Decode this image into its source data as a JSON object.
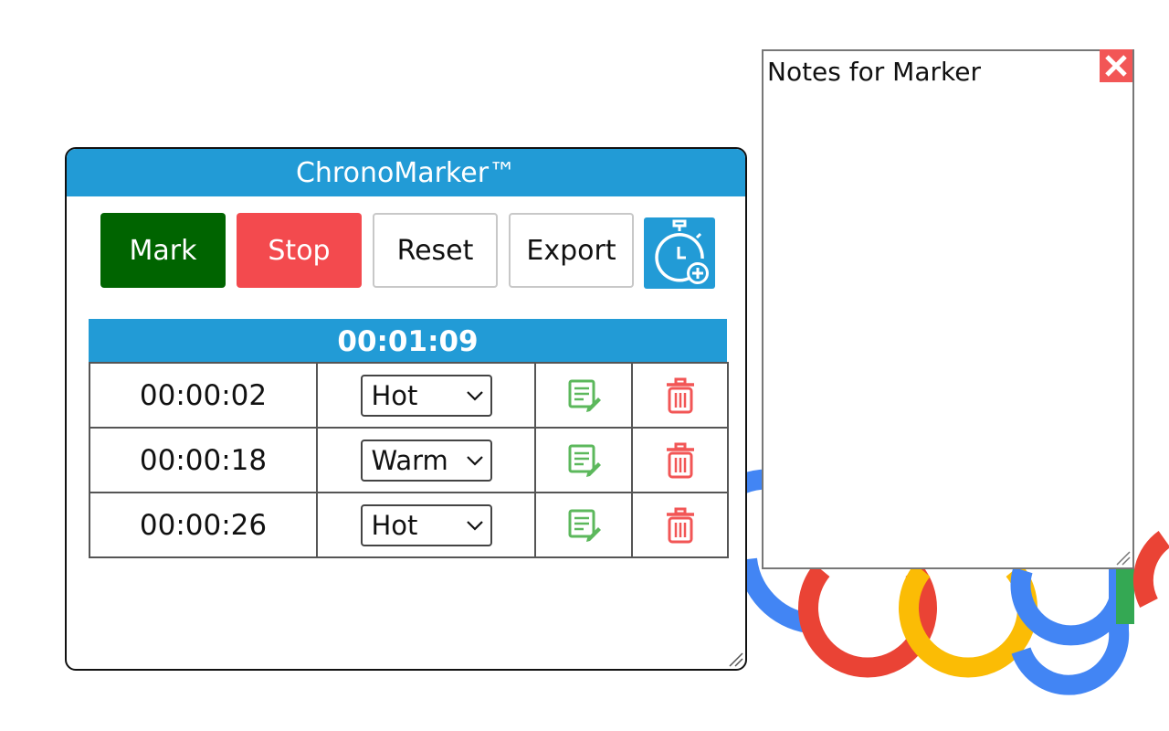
{
  "app": {
    "title": "ChronoMarker™"
  },
  "toolbar": {
    "mark_label": "Mark",
    "stop_label": "Stop",
    "reset_label": "Reset",
    "export_label": "Export",
    "add_timer_icon": "stopwatch-plus-icon"
  },
  "timer": {
    "elapsed": "00:01:09"
  },
  "marks": {
    "rows": [
      {
        "time": "00:00:02",
        "tag": "Hot"
      },
      {
        "time": "00:00:18",
        "tag": "Warm"
      },
      {
        "time": "00:00:26",
        "tag": "Hot"
      }
    ],
    "edit_icon": "edit-note-icon",
    "delete_icon": "trash-icon"
  },
  "notes": {
    "text": "Notes for Marker",
    "close_icon": "close-icon"
  },
  "colors": {
    "header": "#229bd6",
    "mark": "#006400",
    "stop": "#f34a4e",
    "edit_icon": "#5cb85c",
    "delete_icon": "#f25656"
  }
}
